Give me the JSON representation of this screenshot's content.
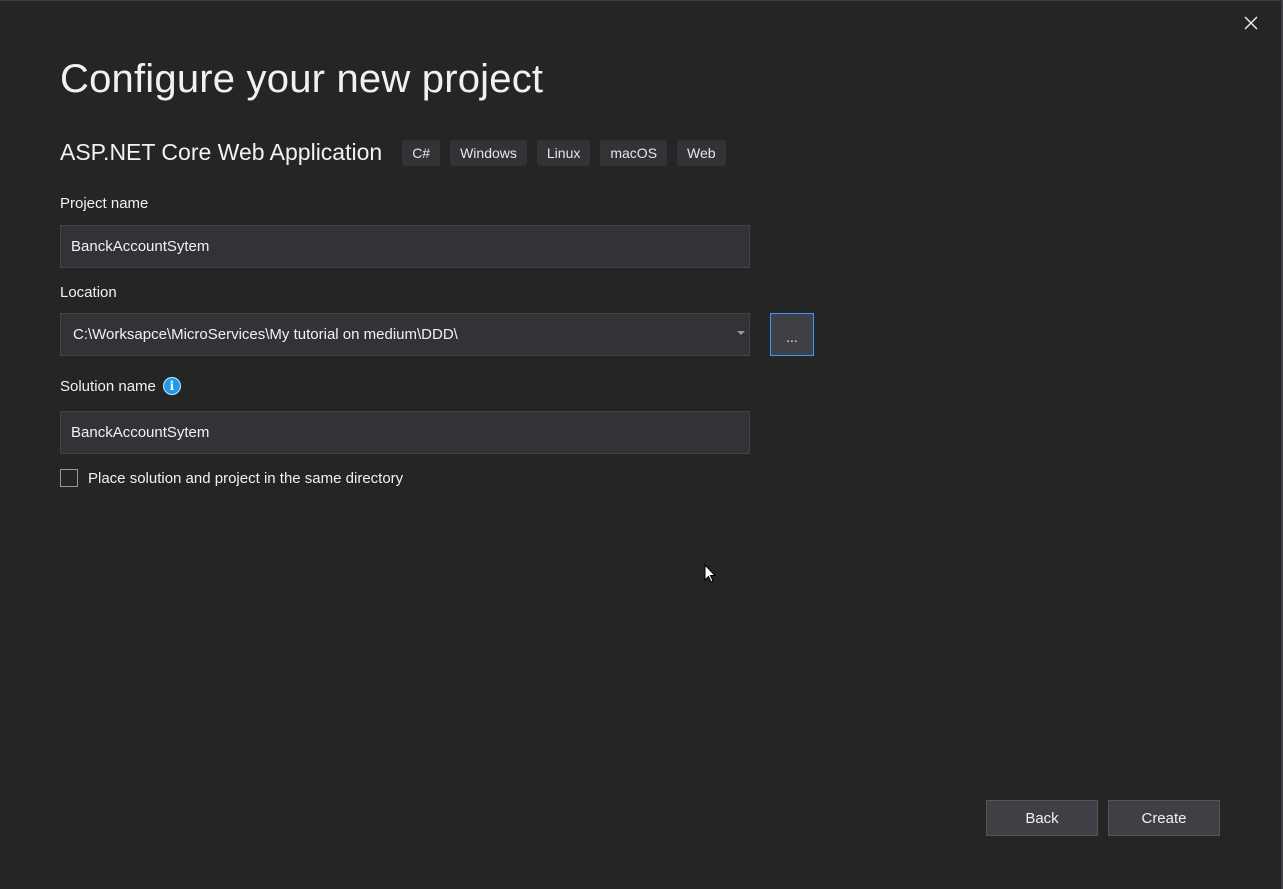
{
  "window": {
    "close_icon": "close-icon"
  },
  "header": {
    "title": "Configure your new project"
  },
  "template": {
    "name": "ASP.NET Core Web Application",
    "tags": [
      "C#",
      "Windows",
      "Linux",
      "macOS",
      "Web"
    ]
  },
  "form": {
    "project_name": {
      "label": "Project name",
      "value": "BanckAccountSytem"
    },
    "location": {
      "label": "Location",
      "value": "C:\\Worksapce\\MicroServices\\My tutorial on medium\\DDD\\",
      "browse_label": "..."
    },
    "solution_name": {
      "label": "Solution name",
      "value": "BanckAccountSytem",
      "info_icon": "info-icon"
    },
    "same_directory": {
      "label": "Place solution and project in the same directory",
      "checked": false
    }
  },
  "footer": {
    "back_label": "Back",
    "create_label": "Create"
  },
  "colors": {
    "background": "#252526",
    "input_background": "#333337",
    "accent": "#3399ff",
    "info": "#1e9be8"
  }
}
